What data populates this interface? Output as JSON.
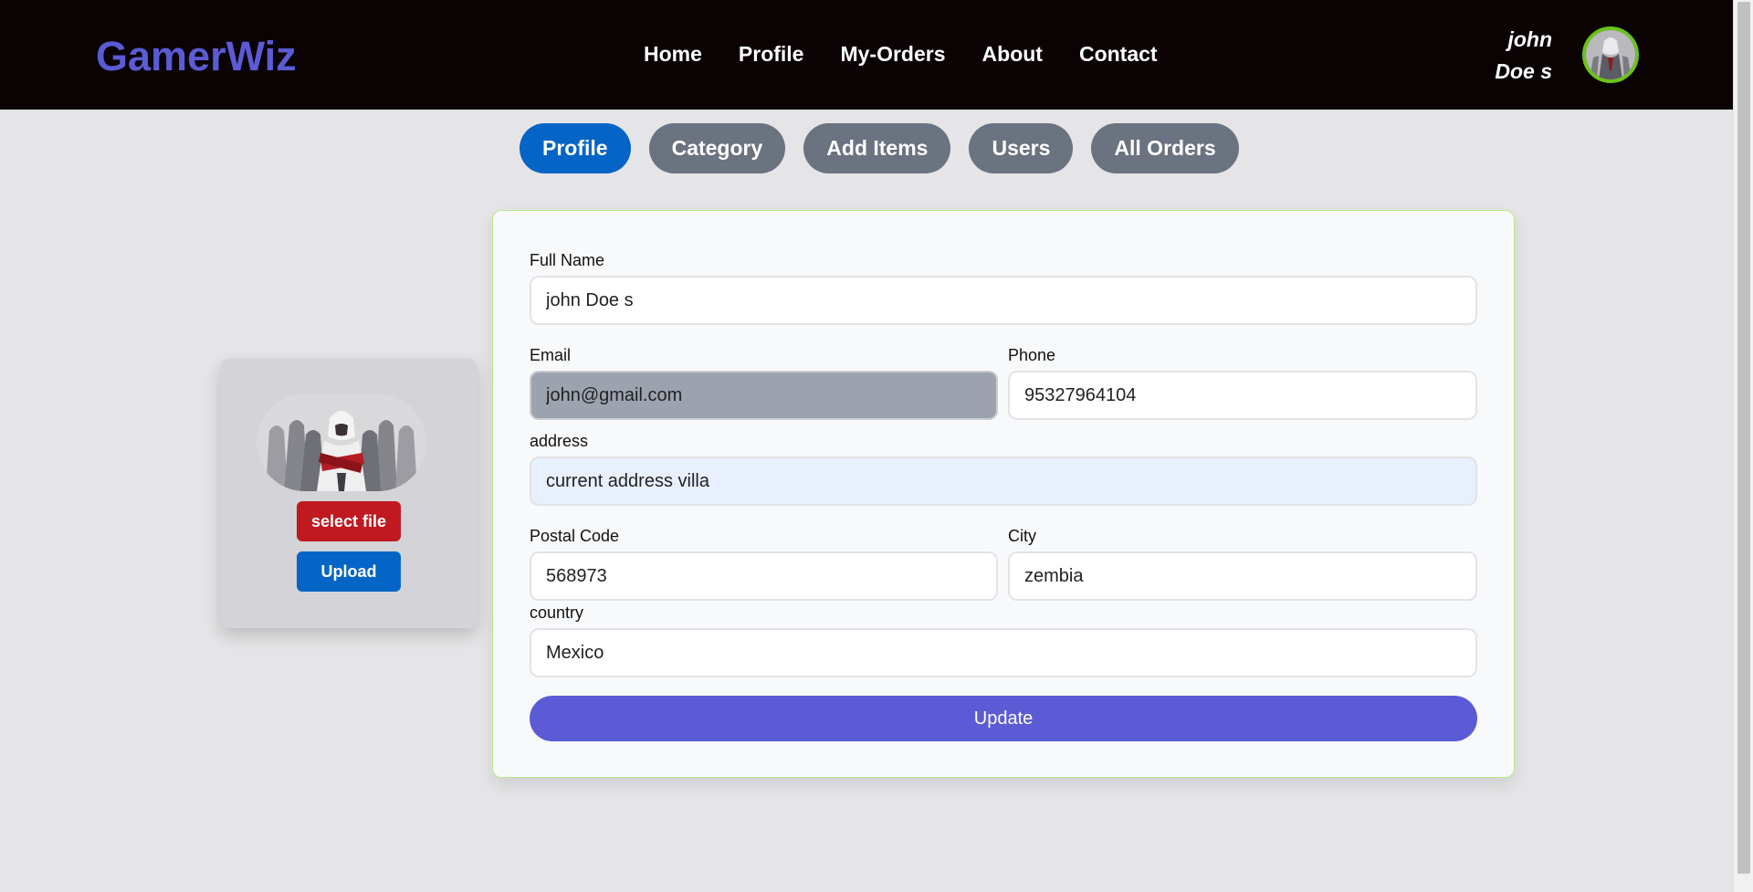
{
  "header": {
    "logo": "GamerWiz",
    "nav": [
      "Home",
      "Profile",
      "My-Orders",
      "About",
      "Contact"
    ],
    "user_name": "john Doe s",
    "avatar_icon": "user-avatar-icon"
  },
  "tabs": [
    {
      "label": "Profile",
      "active": true
    },
    {
      "label": "Category",
      "active": false
    },
    {
      "label": "Add Items",
      "active": false
    },
    {
      "label": "Users",
      "active": false
    },
    {
      "label": "All Orders",
      "active": false
    }
  ],
  "picture_card": {
    "select_label": "select file",
    "upload_label": "Upload"
  },
  "form": {
    "full_name": {
      "label": "Full Name",
      "value": "john Doe s"
    },
    "email": {
      "label": "Email",
      "value": "john@gmail.com"
    },
    "phone": {
      "label": "Phone",
      "value": "95327964104"
    },
    "address": {
      "label": "address",
      "value": "current address villa"
    },
    "postal_code": {
      "label": "Postal Code",
      "value": "568973"
    },
    "city": {
      "label": "City",
      "value": "zembia"
    },
    "country": {
      "label": "country",
      "value": "Mexico"
    },
    "update_label": "Update"
  },
  "colors": {
    "header_bg": "#0a0203",
    "logo": "#5b5bd6",
    "tab_active": "#0565c6",
    "tab_inactive": "#6b7280",
    "select_button": "#c0191f",
    "upload_button": "#0565c6",
    "update_button": "#5b5bd6",
    "form_border": "#b6ec86",
    "avatar_ring": "#6cc21a"
  }
}
